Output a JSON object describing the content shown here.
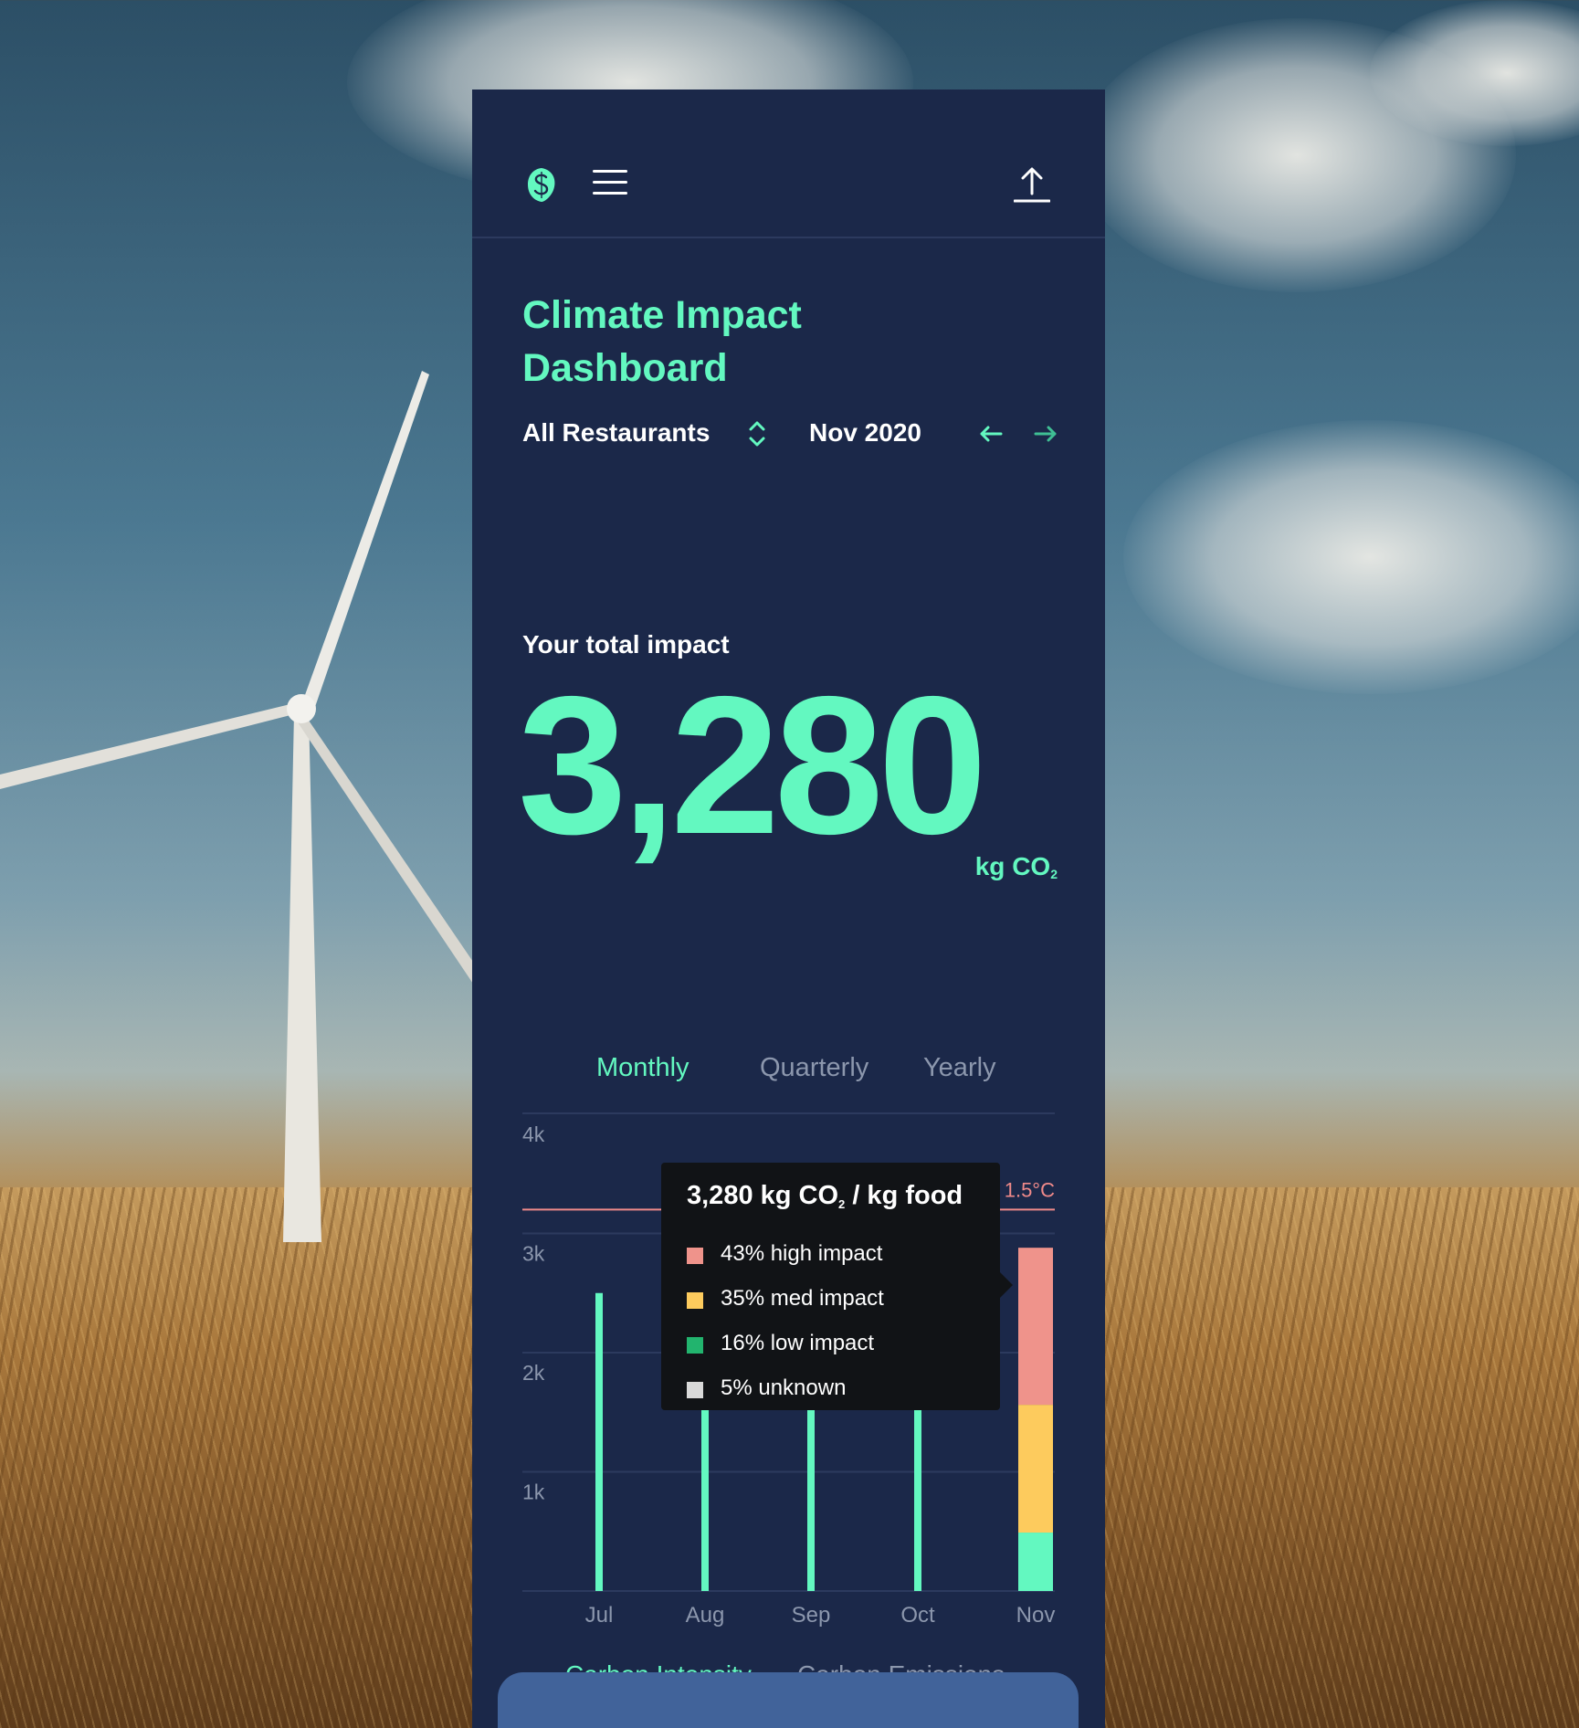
{
  "app": {
    "title_line1": "Climate Impact",
    "title_line2": "Dashboard",
    "brand_color": "#63f8c0"
  },
  "header": {
    "logo_icon": "leaf-s-logo-icon",
    "menu_icon": "hamburger-menu-icon",
    "upload_icon": "upload-icon"
  },
  "filters": {
    "restaurant": "All Restaurants",
    "period": "Nov 2020"
  },
  "total": {
    "label": "Your total impact",
    "value": "3,280",
    "unit": "kg CO",
    "unit_sub": "2"
  },
  "tabs": [
    {
      "label": "Monthly",
      "active": true
    },
    {
      "label": "Quarterly",
      "active": false
    },
    {
      "label": "Yearly",
      "active": false
    }
  ],
  "chart_data": {
    "type": "bar",
    "categories": [
      "Jul",
      "Aug",
      "Sep",
      "Oct",
      "Nov"
    ],
    "yticks": [
      "4k",
      "3k",
      "2k",
      "1k"
    ],
    "ylim": [
      0,
      4000
    ],
    "reference_line": {
      "label": "1.5°C",
      "value": 3200,
      "color": "#f08a8a"
    },
    "values": [
      2500,
      2300,
      2400,
      2350,
      2880
    ],
    "nov_stack": [
      {
        "name": "high impact",
        "share": 0.43,
        "color": "#ef938b"
      },
      {
        "name": "med impact",
        "share": 0.35,
        "color": "#fdcb5d"
      },
      {
        "name": "low impact",
        "share": 0.16,
        "color": "#63f8c0"
      },
      {
        "name": "unknown",
        "share": 0.05,
        "color": "#d9d9d9"
      }
    ]
  },
  "tooltip": {
    "title": "3,280 kg CO",
    "title_sub": "2",
    "title_suffix": " / kg food",
    "rows": [
      {
        "text": "43% high impact",
        "color": "#ef938b"
      },
      {
        "text": "35% med impact",
        "color": "#fdcb5d"
      },
      {
        "text": "16% low impact",
        "color": "#22b46e"
      },
      {
        "text": "5% unknown",
        "color": "#d9d9d9"
      }
    ]
  },
  "subtabs": [
    {
      "label": "Carbon Intensity",
      "active": true
    },
    {
      "label": "Carbon Emissions",
      "active": false
    }
  ]
}
